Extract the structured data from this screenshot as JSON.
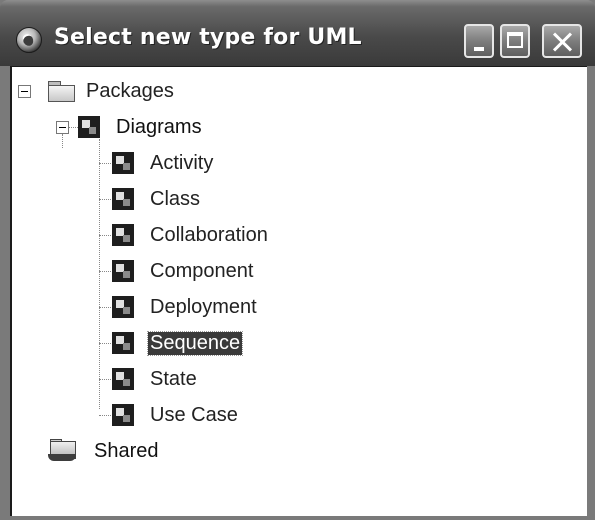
{
  "window": {
    "title": "Select new type for UML",
    "controls": {
      "minimize_icon": "minimize-icon",
      "maximize_icon": "maximize-icon",
      "close_icon": "close-icon"
    }
  },
  "tree": {
    "root": {
      "label": "Packages",
      "icon": "folder-icon",
      "expanded": true
    },
    "diagrams": {
      "label": "Diagrams",
      "icon": "diagram-icon",
      "expanded": true
    },
    "children": [
      {
        "label": "Activity",
        "icon": "diagram-icon"
      },
      {
        "label": "Class",
        "icon": "diagram-icon"
      },
      {
        "label": "Collaboration",
        "icon": "diagram-icon"
      },
      {
        "label": "Component",
        "icon": "diagram-icon"
      },
      {
        "label": "Deployment",
        "icon": "diagram-icon"
      },
      {
        "label": "Sequence",
        "icon": "diagram-icon",
        "selected": true
      },
      {
        "label": "State",
        "icon": "diagram-icon"
      },
      {
        "label": "Use Case",
        "icon": "diagram-icon"
      }
    ],
    "shared": {
      "label": "Shared",
      "icon": "shared-folder-icon"
    }
  }
}
